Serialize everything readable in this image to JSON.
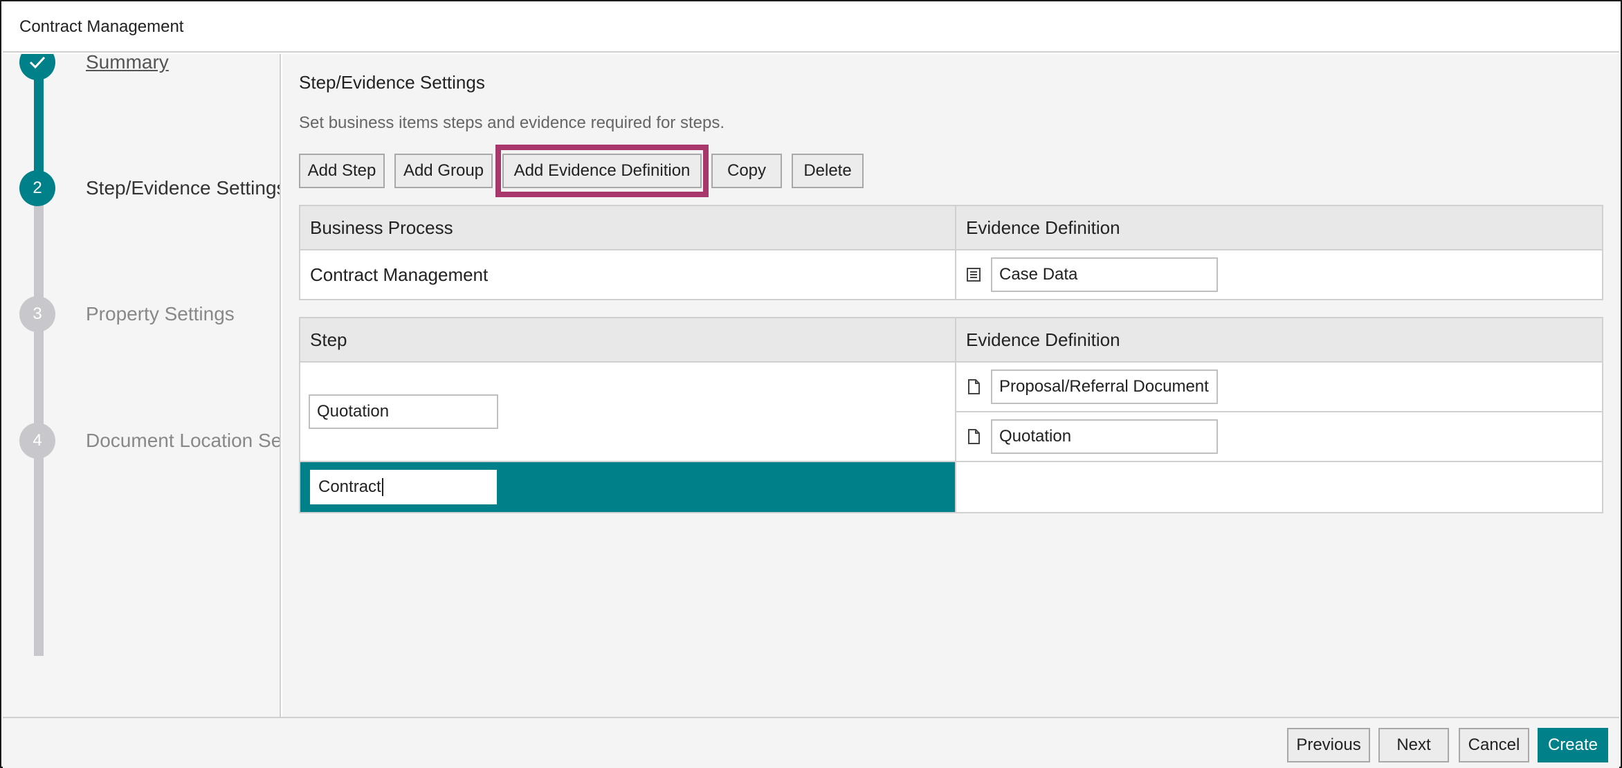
{
  "window": {
    "title": "Contract Management"
  },
  "wizard": {
    "steps": [
      {
        "number": "",
        "label": "Summary",
        "state": "completed",
        "icon": "check-icon"
      },
      {
        "number": "2",
        "label": "Step/Evidence Settings",
        "state": "active"
      },
      {
        "number": "3",
        "label": "Property Settings",
        "state": "inactive"
      },
      {
        "number": "4",
        "label": "Document Location Settings",
        "state": "inactive"
      }
    ]
  },
  "content": {
    "heading": "Step/Evidence Settings",
    "description": "Set business items steps and evidence required for steps.",
    "toolbar": {
      "add_step": "Add Step",
      "add_group": "Add Group",
      "add_evidence_definition": "Add Evidence Definition",
      "copy": "Copy",
      "delete": "Delete"
    },
    "process_table": {
      "headers": [
        "Business Process",
        "Evidence Definition"
      ],
      "row": {
        "process": "Contract Management",
        "evidence": "Case Data",
        "evidence_icon": "list-document-icon"
      }
    },
    "step_table": {
      "headers": [
        "Step",
        "Evidence Definition"
      ],
      "rows": [
        {
          "step": "Quotation",
          "evidence": [
            "Proposal/Referral Document",
            "Quotation"
          ],
          "evidence_icon": "document-icon"
        },
        {
          "step": "Contract",
          "evidence": [],
          "selected": true
        }
      ]
    }
  },
  "footer": {
    "previous": "Previous",
    "next": "Next",
    "cancel": "Cancel",
    "create": "Create"
  },
  "colors": {
    "accent": "#00818a",
    "highlight": "#a8386b",
    "inactive_step": "#c8c8cc"
  }
}
